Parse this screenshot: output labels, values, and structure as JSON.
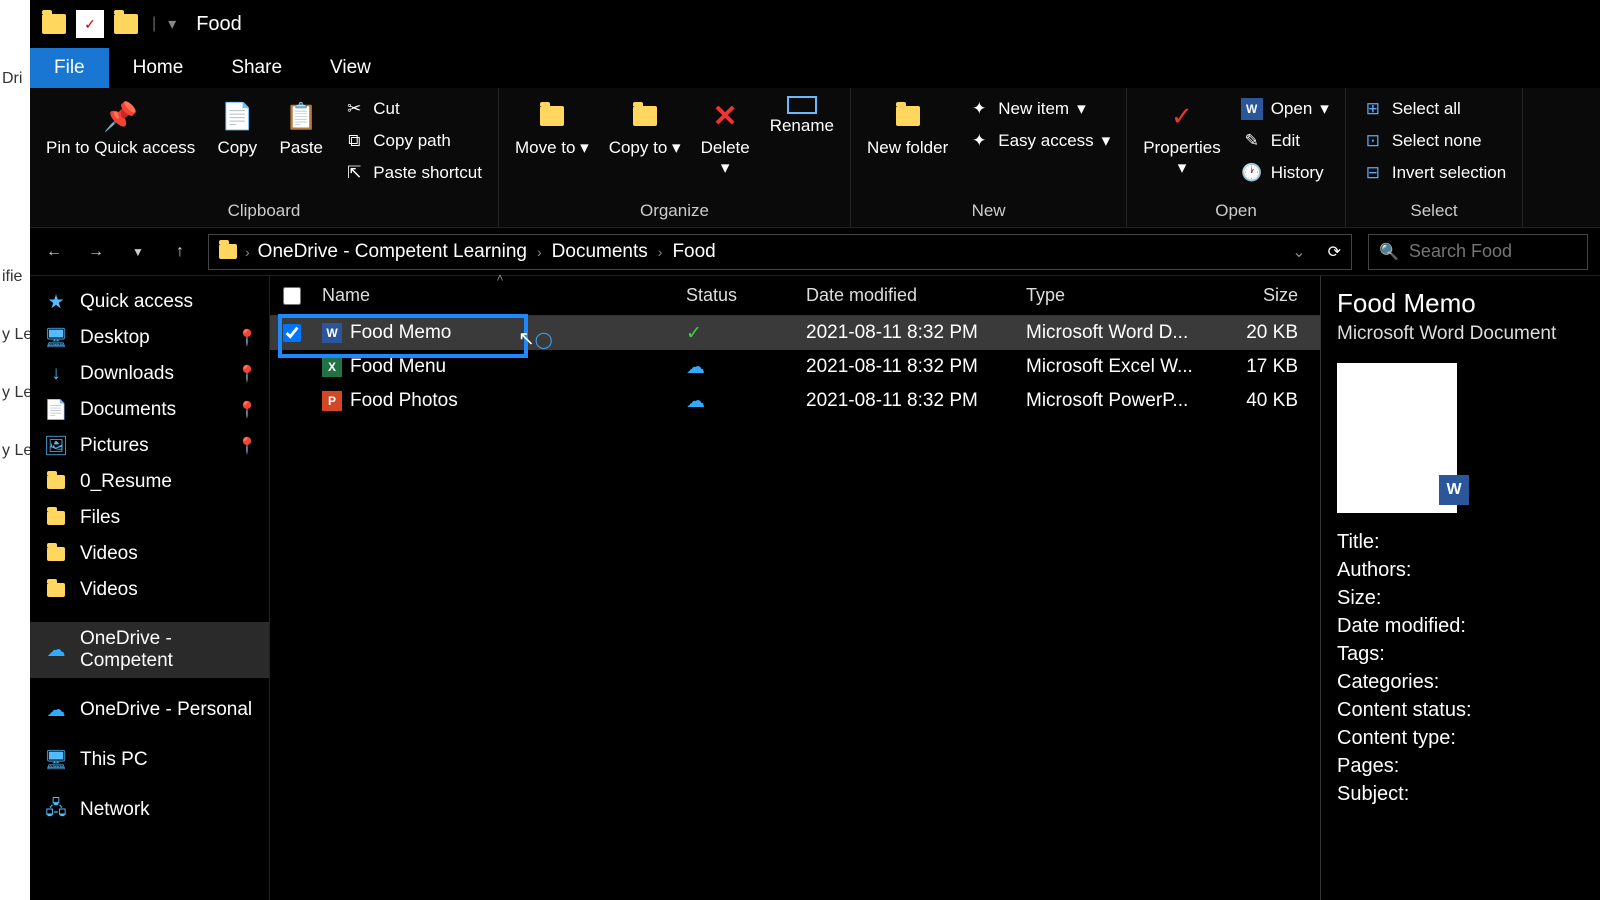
{
  "title": "Food",
  "tabs": {
    "file": "File",
    "home": "Home",
    "share": "Share",
    "view": "View"
  },
  "ribbon": {
    "clipboard": {
      "label": "Clipboard",
      "pin": "Pin to Quick access",
      "copy": "Copy",
      "paste": "Paste",
      "cut": "Cut",
      "copy_path": "Copy path",
      "paste_shortcut": "Paste shortcut"
    },
    "organize": {
      "label": "Organize",
      "move_to": "Move to",
      "copy_to": "Copy to",
      "delete": "Delete",
      "rename": "Rename"
    },
    "new": {
      "label": "New",
      "new_folder": "New folder",
      "new_item": "New item",
      "easy_access": "Easy access"
    },
    "open": {
      "label": "Open",
      "properties": "Properties",
      "open": "Open",
      "edit": "Edit",
      "history": "History"
    },
    "select": {
      "label": "Select",
      "select_all": "Select all",
      "select_none": "Select none",
      "invert": "Invert selection"
    }
  },
  "breadcrumb": [
    "OneDrive - Competent Learning",
    "Documents",
    "Food"
  ],
  "search_placeholder": "Search Food",
  "sidebar": {
    "quick_access": "Quick access",
    "desktop": "Desktop",
    "downloads": "Downloads",
    "documents": "Documents",
    "pictures": "Pictures",
    "resume": "0_Resume",
    "files": "Files",
    "videos1": "Videos",
    "videos2": "Videos",
    "onedrive_comp": "OneDrive - Competent",
    "onedrive_pers": "OneDrive - Personal",
    "this_pc": "This PC",
    "network": "Network"
  },
  "columns": {
    "name": "Name",
    "status": "Status",
    "date": "Date modified",
    "type": "Type",
    "size": "Size"
  },
  "files": [
    {
      "name": "Food Memo",
      "date": "2021-08-11 8:32 PM",
      "type": "Microsoft Word D...",
      "size": "20 KB",
      "status": "synced",
      "icon": "W",
      "selected": true
    },
    {
      "name": "Food Menu",
      "date": "2021-08-11 8:32 PM",
      "type": "Microsoft Excel W...",
      "size": "17 KB",
      "status": "cloud",
      "icon": "X",
      "selected": false
    },
    {
      "name": "Food Photos",
      "date": "2021-08-11 8:32 PM",
      "type": "Microsoft PowerP...",
      "size": "40 KB",
      "status": "cloud",
      "icon": "P",
      "selected": false
    }
  ],
  "details": {
    "title": "Food Memo",
    "type": "Microsoft Word Document",
    "fields": [
      "Title:",
      "Authors:",
      "Size:",
      "Date modified:",
      "Tags:",
      "Categories:",
      "Content status:",
      "Content type:",
      "Pages:",
      "Subject:"
    ]
  },
  "left_edge": [
    "Dri",
    "ifie",
    "y Le",
    "y Le",
    "y Le"
  ]
}
